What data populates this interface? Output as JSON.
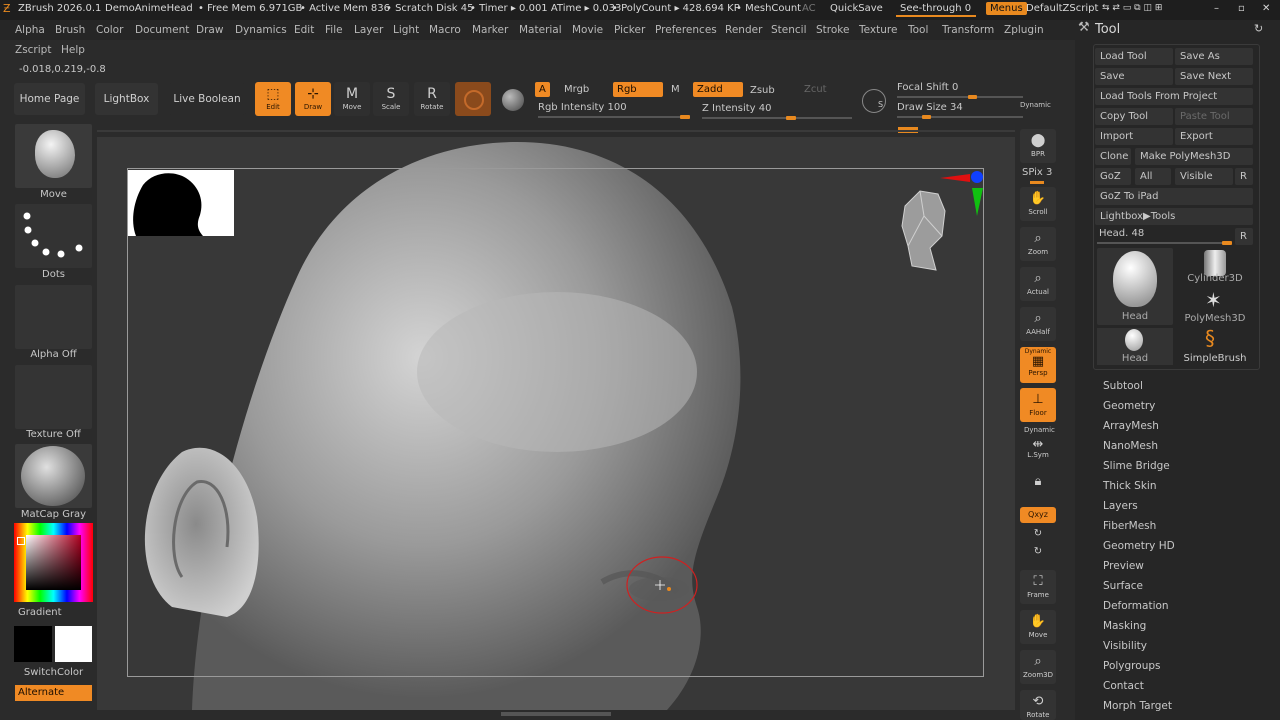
{
  "titlebar": {
    "app": "ZBrush 2026.0.1",
    "document": "DemoAnimeHead",
    "free_mem": "• Free Mem 6.971GB",
    "active_mem": "• Active Mem 836",
    "scratch": "• Scratch Disk 45",
    "timer": "• Timer ▸ 0.001 ATime ▸ 0.033",
    "polycount": "• PolyCount ▸ 428.694 KP",
    "meshcount": "• MeshCount",
    "ac": "AC",
    "quicksave": "QuickSave",
    "see_through": "See-through  0",
    "menus": "Menus",
    "default_script": "DefaultZScript"
  },
  "menu": [
    "Alpha",
    "Brush",
    "Color",
    "Document",
    "Draw",
    "Dynamics",
    "Edit",
    "File",
    "Layer",
    "Light",
    "Macro",
    "Marker",
    "Material",
    "Movie",
    "Picker",
    "Preferences",
    "Render",
    "Stencil",
    "Stroke",
    "Texture",
    "Tool",
    "Transform",
    "Zplugin"
  ],
  "menu2": [
    "Zscript",
    "Help"
  ],
  "coords": "-0.018,0.219,-0.8",
  "shelf": {
    "home": "Home Page",
    "lightbox": "LightBox",
    "live_boolean": "Live Boolean",
    "edit": "Edit",
    "draw": "Draw",
    "move": "Move",
    "scale": "Scale",
    "rotate": "Rotate",
    "a": "A",
    "mrgb": "Mrgb",
    "rgb": "Rgb",
    "m": "M",
    "zadd": "Zadd",
    "zsub": "Zsub",
    "zcut": "Zcut",
    "rgb_intensity": "Rgb Intensity 100",
    "z_intensity": "Z Intensity 40",
    "focal_shift": "Focal Shift 0",
    "draw_size": "Draw Size 34",
    "dynamic": "Dynamic",
    "rgb_intensity_level": 1.0,
    "z_intensity_level": 0.4
  },
  "left": {
    "brush": "Move",
    "stroke": "Dots",
    "alpha": "Alpha Off",
    "texture": "Texture Off",
    "material": "MatCap Gray",
    "gradient": "Gradient",
    "switch": "SwitchColor",
    "alternate": "Alternate"
  },
  "righttools": {
    "bpr": "BPR",
    "spix": "SPix 3",
    "scroll": "Scroll",
    "zoom": "Zoom",
    "actual": "Actual",
    "aahalf": "AAHalf",
    "dynamic": "Dynamic",
    "persp": "Persp",
    "floor": "Floor",
    "dynamic2": "Dynamic",
    "lsym": "L.Sym",
    "xyz": "Qxyz",
    "frame": "Frame",
    "move": "Move",
    "zoom3d": "Zoom3D",
    "rotate": "Rotate"
  },
  "tool": {
    "header": "Tool",
    "load_tool": "Load Tool",
    "save_as": "Save As",
    "save": "Save",
    "save_next": "Save Next",
    "load_from_project": "Load Tools From Project",
    "copy_tool": "Copy Tool",
    "paste_tool": "Paste Tool",
    "import": "Import",
    "export": "Export",
    "clone": "Clone",
    "make_polymesh": "Make PolyMesh3D",
    "goz": "GoZ",
    "all": "All",
    "visible": "Visible",
    "r": "R",
    "goz_ipad": "GoZ To iPad",
    "lightbox_tools": "Lightbox▶Tools",
    "head_slider": "Head. 48",
    "thumbs": [
      "Head",
      "Cylinder3D",
      "PolyMesh3D",
      "Head",
      "SimpleBrush"
    ],
    "subpalettes": [
      "Subtool",
      "Geometry",
      "ArrayMesh",
      "NanoMesh",
      "Slime Bridge",
      "Thick Skin",
      "Layers",
      "FiberMesh",
      "Geometry HD",
      "Preview",
      "Surface",
      "Deformation",
      "Masking",
      "Visibility",
      "Polygroups",
      "Contact",
      "Morph Target"
    ]
  }
}
